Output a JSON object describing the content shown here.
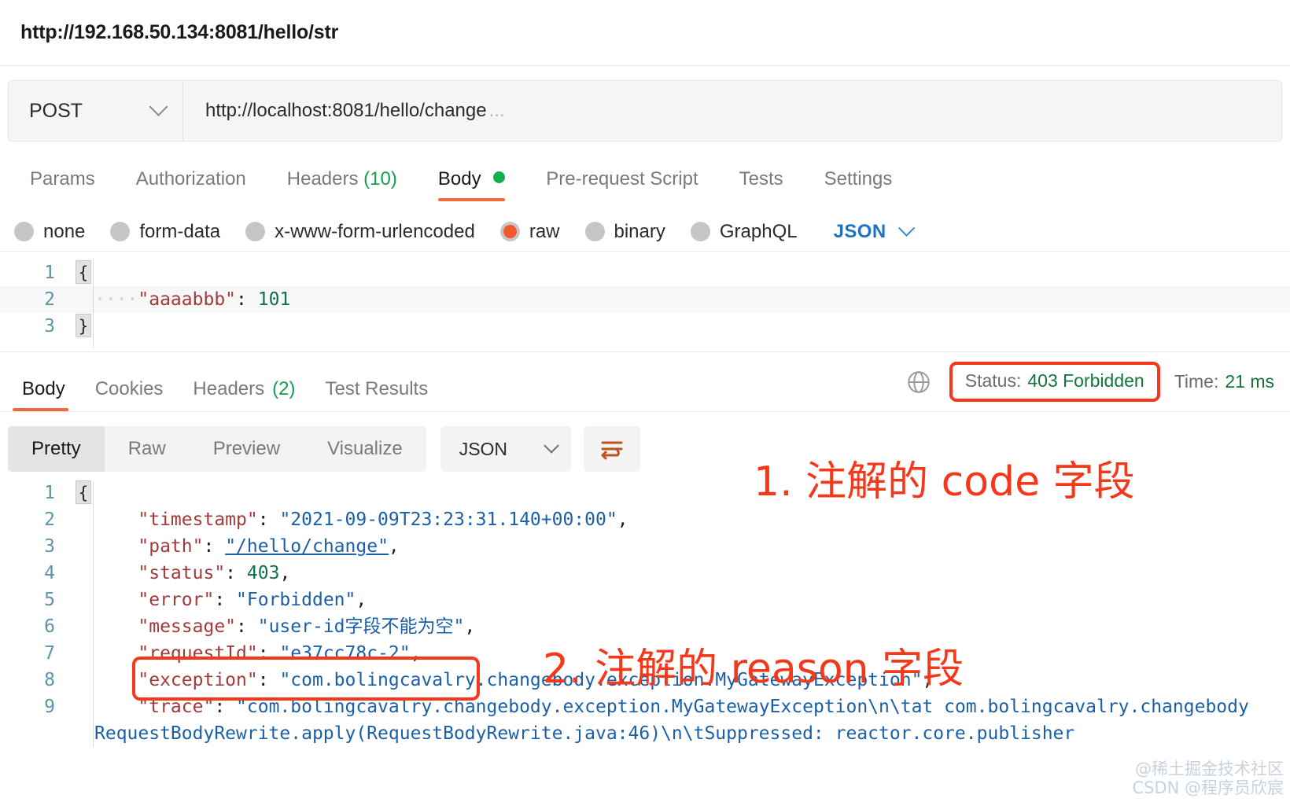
{
  "titlebar": {
    "url": "http://192.168.50.134:8081/hello/str"
  },
  "request": {
    "method": "POST",
    "url": "http://localhost:8081/hello/change",
    "url_ellipsis": "...",
    "tabs": [
      {
        "label": "Params",
        "count": "",
        "active": false
      },
      {
        "label": "Authorization",
        "count": "",
        "active": false
      },
      {
        "label": "Headers",
        "count": "(10)",
        "active": false
      },
      {
        "label": "Body",
        "count": "",
        "active": true
      },
      {
        "label": "Pre-request Script",
        "count": "",
        "active": false
      },
      {
        "label": "Tests",
        "count": "",
        "active": false
      },
      {
        "label": "Settings",
        "count": "",
        "active": false
      }
    ],
    "body_types": [
      {
        "label": "none",
        "selected": false
      },
      {
        "label": "form-data",
        "selected": false
      },
      {
        "label": "x-www-form-urlencoded",
        "selected": false
      },
      {
        "label": "raw",
        "selected": true
      },
      {
        "label": "binary",
        "selected": false
      },
      {
        "label": "GraphQL",
        "selected": false
      }
    ],
    "raw_format": "JSON",
    "body_lines": [
      {
        "num": "1",
        "fold": "{",
        "indent": "",
        "key": "",
        "colon": "",
        "value": "",
        "value_type": "",
        "tail": ""
      },
      {
        "num": "2",
        "fold": "",
        "indent": "····",
        "key": "\"aaaabbb\"",
        "colon": ":",
        "value": "101",
        "value_type": "n",
        "tail": ""
      },
      {
        "num": "3",
        "fold": "}",
        "indent": "",
        "key": "",
        "colon": "",
        "value": "",
        "value_type": "",
        "tail": ""
      }
    ]
  },
  "response": {
    "tabs": [
      {
        "label": "Body",
        "count": "",
        "active": true
      },
      {
        "label": "Cookies",
        "count": "",
        "active": false
      },
      {
        "label": "Headers",
        "count": "(2)",
        "active": false
      },
      {
        "label": "Test Results",
        "count": "",
        "active": false
      }
    ],
    "status_label": "Status:",
    "status_value": "403 Forbidden",
    "time_label": "Time:",
    "time_value": "21 ms",
    "view_modes": [
      {
        "label": "Pretty",
        "active": true
      },
      {
        "label": "Raw",
        "active": false
      },
      {
        "label": "Preview",
        "active": false
      },
      {
        "label": "Visualize",
        "active": false
      }
    ],
    "format": "JSON",
    "body_lines": [
      {
        "num": "1",
        "fold": "{",
        "key": "",
        "colon": "",
        "value": "",
        "value_type": "",
        "tail": ""
      },
      {
        "num": "2",
        "fold": "",
        "key": "\"timestamp\"",
        "colon": ":",
        "value": "\"2021-09-09T23:23:31.140+00:00\"",
        "value_type": "s",
        "tail": ","
      },
      {
        "num": "3",
        "fold": "",
        "key": "\"path\"",
        "colon": ":",
        "value": "\"/hello/change\"",
        "value_type": "link",
        "tail": ","
      },
      {
        "num": "4",
        "fold": "",
        "key": "\"status\"",
        "colon": ":",
        "value": "403",
        "value_type": "n",
        "tail": ","
      },
      {
        "num": "5",
        "fold": "",
        "key": "\"error\"",
        "colon": ":",
        "value": "\"Forbidden\"",
        "value_type": "s",
        "tail": ","
      },
      {
        "num": "6",
        "fold": "",
        "key": "\"message\"",
        "colon": ":",
        "value": "\"user-id字段不能为空\"",
        "value_type": "s",
        "tail": ","
      },
      {
        "num": "7",
        "fold": "",
        "key": "\"requestId\"",
        "colon": ":",
        "value": "\"e37cc78c-2\"",
        "value_type": "s",
        "tail": ","
      },
      {
        "num": "8",
        "fold": "",
        "key": "\"exception\"",
        "colon": ":",
        "value": "\"com.bolingcavalry.changebody.exception.MyGatewayException\"",
        "value_type": "s",
        "tail": ","
      },
      {
        "num": "9",
        "fold": "",
        "key": "\"trace\"",
        "colon": ":",
        "value": "\"com.bolingcavalry.changebody.exception.MyGatewayException\\n\\tat com.bolingcavalry.changebody",
        "value_type": "s",
        "tail": ""
      }
    ],
    "body_wrapped_line": "RequestBodyRewrite.apply(RequestBodyRewrite.java:46)\\n\\tSuppressed: reactor.core.publisher"
  },
  "annotations": {
    "note1": "1. 注解的 code 字段",
    "note2": "2. 注解的 reason 字段",
    "color": "#f5371a"
  },
  "watermark": {
    "line1": "@稀土掘金技术社区",
    "line2": "CSDN @程序员欣宸"
  },
  "colors": {
    "accent_orange": "#ef6c3a",
    "status_green": "#12753c",
    "annotation_red": "#f5371a",
    "json_link_blue": "#1a73c4"
  }
}
